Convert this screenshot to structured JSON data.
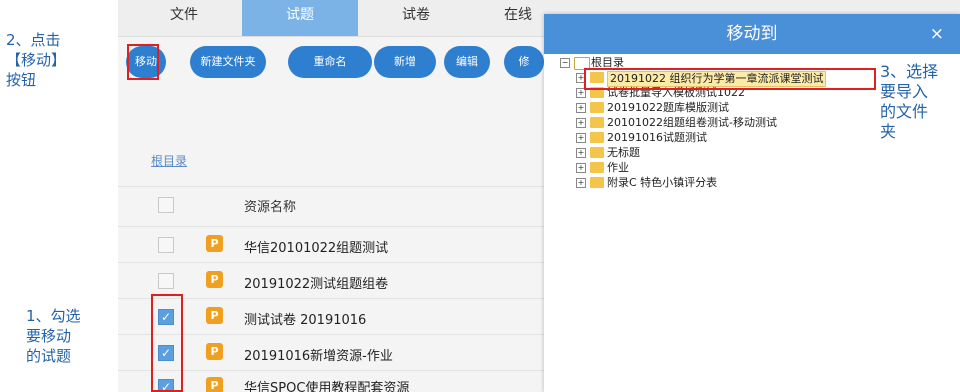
{
  "tabs": [
    {
      "label": "文件"
    },
    {
      "label": "试题"
    },
    {
      "label": "试卷"
    },
    {
      "label": "在线"
    }
  ],
  "toolbar": {
    "move": "移动",
    "new_folder": "新建文件夹",
    "rename": "重命名",
    "add": "新增",
    "edit": "编辑",
    "more": "修"
  },
  "breadcrumb": "根目录",
  "list": {
    "header": "资源名称",
    "rows": [
      {
        "name": "华信20101022组题测试",
        "checked": false
      },
      {
        "name": "20191022测试组题组卷",
        "checked": false
      },
      {
        "name": "测试试卷 20191016",
        "checked": true
      },
      {
        "name": "20191016新增资源-作业",
        "checked": true
      },
      {
        "name": "华信SPOC使用教程配套资源",
        "checked": true
      }
    ]
  },
  "modal": {
    "title": "移动到",
    "close": "×",
    "root": "根目录",
    "folders": [
      "20191022 组织行为学第一章流派课堂测试",
      "试卷批量导入模板测试1022",
      "20191022题库模版测试",
      "20101022组题组卷测试-移动测试",
      "20191016试题测试",
      "无标题",
      "作业",
      "附录C 特色小镇评分表"
    ]
  },
  "annotations": {
    "step2": [
      "2、点击",
      "【移动】",
      "按钮"
    ],
    "step1": [
      "1、勾选",
      "要移动",
      "的试题"
    ],
    "step3": [
      "3、选择",
      "要导入",
      "的文件",
      "夹"
    ]
  },
  "colors": {
    "primary": "#2f7fd1",
    "modal_header": "#4a90d9",
    "annotation": "#2563a8",
    "highlight_box": "#e02020",
    "folder": "#f3c64b",
    "question_icon": "#f0a020"
  },
  "icons": {
    "question": "P",
    "check": "✓",
    "expand": "+",
    "collapse": "−"
  }
}
